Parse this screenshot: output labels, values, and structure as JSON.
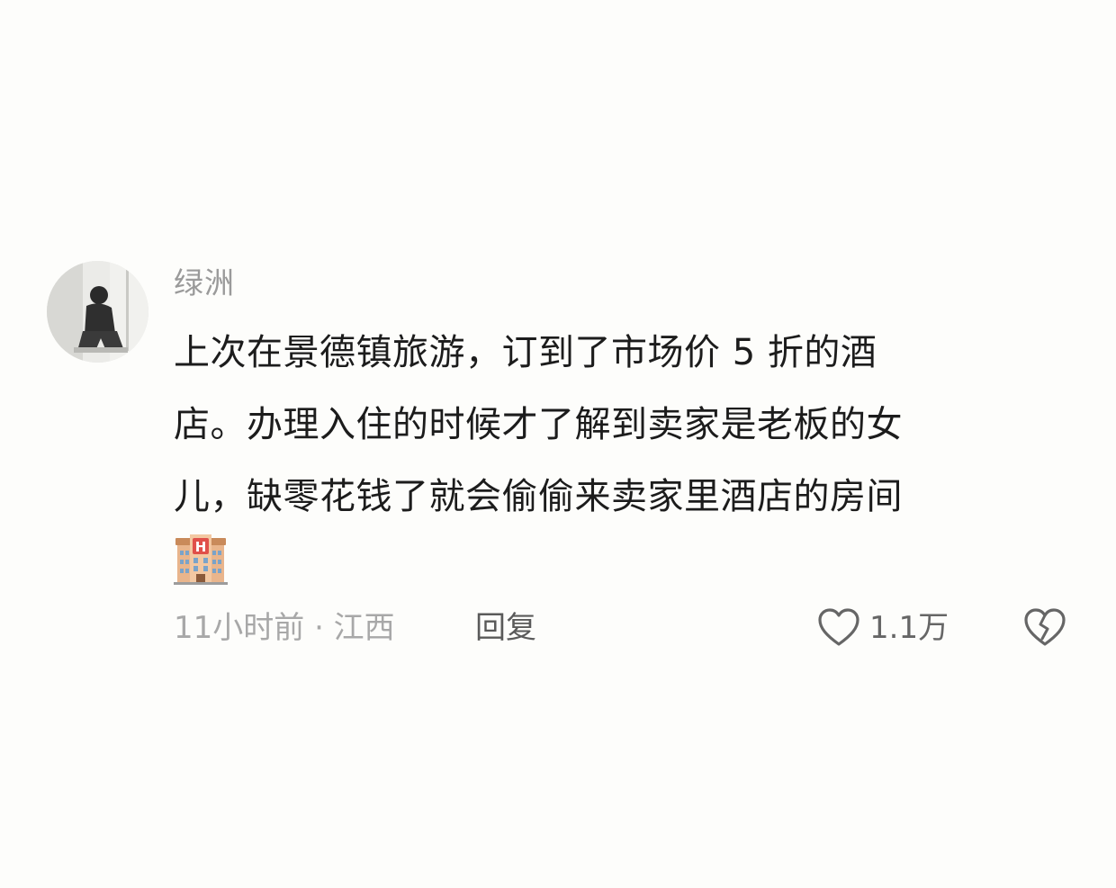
{
  "comment": {
    "username": "绿洲",
    "body_lines": [
      "上次在景德镇旅游，订到了市场价 5 折的酒",
      "店。办理入住的时候才了解到卖家是老板的女",
      "儿，缺零花钱了就会偷偷来卖家里酒店的房间"
    ],
    "emoji": "hotel-icon",
    "meta": "11小时前 · 江西",
    "reply_label": "回复",
    "like_count": "1.1万"
  },
  "icons": {
    "like": "heart-outline-icon",
    "dislike": "broken-heart-icon"
  },
  "colors": {
    "background": "#fdfdfb",
    "text_primary": "#1c1c1c",
    "text_secondary": "#9a9a9a",
    "action_text": "#5a5a5a"
  }
}
